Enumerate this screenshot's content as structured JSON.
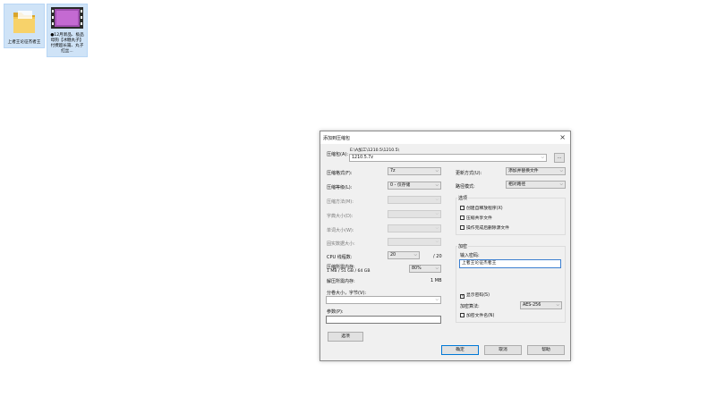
{
  "desktop": {
    "icons": [
      {
        "label": "上者王论征杰者王",
        "icon": "folder-icon"
      },
      {
        "label": "●12月新品、极品母狗【冰糖丸子】付费超长篇、丸子红丝...",
        "icon": "video-thumbnail-icon"
      }
    ]
  },
  "dialog": {
    "title": "添加到压缩包",
    "close_glyph": "×",
    "archive": {
      "label": "压缩包(A):",
      "path_line": "E:\\A加工\\1210.5\\1210.5\\",
      "value": "1210.5.7z",
      "browse_label": "..."
    },
    "left_fields": [
      {
        "label": "压缩格式(F):",
        "value": "7z",
        "disabled": false
      },
      {
        "label": "压缩等级(L):",
        "value": "0 - 仅存储",
        "disabled": false
      },
      {
        "label": "压缩方法(M):",
        "value": "",
        "disabled": true
      },
      {
        "label": "字典大小(D):",
        "value": "",
        "disabled": true
      },
      {
        "label": "单词大小(W):",
        "value": "",
        "disabled": true
      },
      {
        "label": "固实数据大小:",
        "value": "",
        "disabled": true
      }
    ],
    "cpu": {
      "label": "CPU 线程数:",
      "value": "20",
      "total": "/ 20"
    },
    "memory": {
      "label": "压缩所需内存:",
      "detail": "1 MB / 51 GB / 64 GB",
      "value": "80%",
      "decompress_label": "解压所需内存:",
      "decompress_value": "1 MB"
    },
    "split": {
      "label": "分卷大小，字节(V):",
      "value": ""
    },
    "params": {
      "label": "参数(P):",
      "value": ""
    },
    "options_button": "选项",
    "right_fields": [
      {
        "label": "更新方式(U):",
        "value": "添加并替换文件"
      },
      {
        "label": "路径模式:",
        "value": "相对路径"
      }
    ],
    "options_group": {
      "title": "选项",
      "items": [
        {
          "label": "创建自释放程序(X)",
          "checked": false
        },
        {
          "label": "压缩共享文件",
          "checked": false
        },
        {
          "label": "操作完成后删除源文件",
          "checked": false
        }
      ]
    },
    "encryption_group": {
      "title": "加密",
      "password_label": "输入密码:",
      "password_value": "上者王论征杰者王",
      "show_password_label": "显示密码(S)",
      "show_password_checked": true,
      "method_label": "加密算法:",
      "method_value": "AES-256",
      "encrypt_names_label": "加密文件名(N)",
      "encrypt_names_checked": false
    },
    "buttons": {
      "ok": "确定",
      "cancel": "取消",
      "help": "帮助"
    }
  },
  "colors": {
    "dialog_bg": "#f0f0f0",
    "selection_bg": "#cfe3f7",
    "folder": "#e8b83a",
    "accent": "#0078d7"
  }
}
